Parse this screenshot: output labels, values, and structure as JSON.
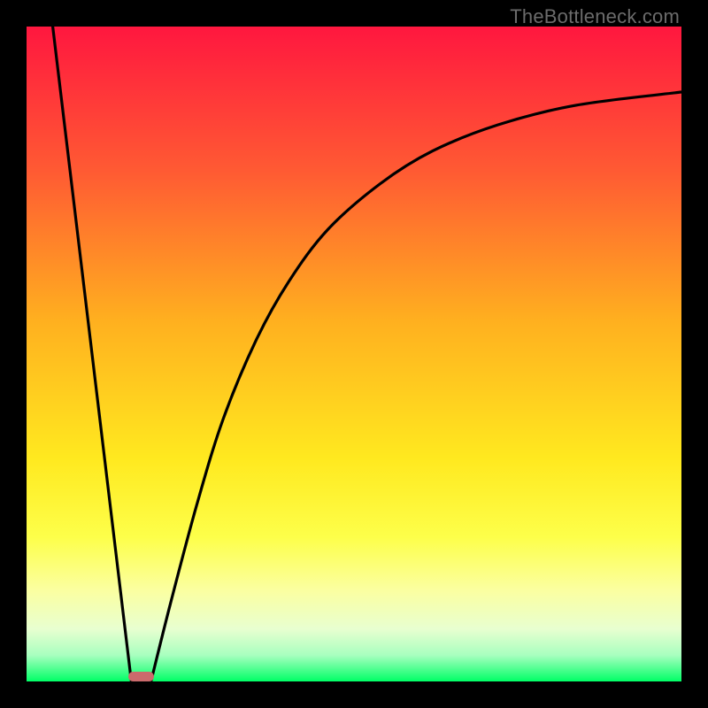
{
  "watermark": {
    "text": "TheBottleneck.com"
  },
  "colors": {
    "black": "#000000",
    "gradient_top": "#ff173f",
    "gradient_mid1": "#ff7a2d",
    "gradient_mid2": "#ffd21f",
    "gradient_low": "#fdff4a",
    "gradient_pale": "#f3ffb0",
    "gradient_bottom": "#00ff66",
    "curve": "#000000",
    "marker": "#cb6a6c"
  },
  "chart_data": {
    "type": "line",
    "title": "",
    "xlabel": "",
    "ylabel": "",
    "xlim": [
      0,
      100
    ],
    "ylim": [
      0,
      100
    ],
    "series": [
      {
        "name": "left-slope",
        "x": [
          4,
          16
        ],
        "values": [
          100,
          0
        ]
      },
      {
        "name": "right-curve",
        "x": [
          19,
          22,
          26,
          30,
          35,
          40,
          46,
          54,
          62,
          72,
          84,
          100
        ],
        "values": [
          0,
          12,
          27,
          40,
          52,
          61,
          69,
          76,
          81,
          85,
          88,
          90
        ]
      }
    ],
    "annotations": [
      {
        "name": "optimum-marker",
        "x": 17.5,
        "y": 0,
        "w": 3.8,
        "h": 1.5
      }
    ]
  }
}
